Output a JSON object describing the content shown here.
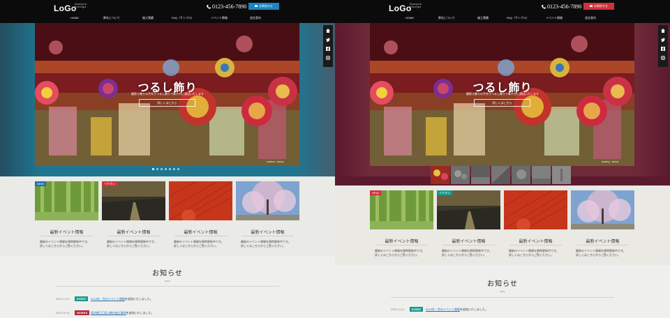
{
  "brand": {
    "logo": "LoGo",
    "logo_sub_1": "Sample",
    "logo_sub_2": "Design"
  },
  "header": {
    "phone": "0123-456-7890",
    "contact_label": "お問合わせ"
  },
  "nav": [
    "HOME",
    "弊社について",
    "施工実績",
    "FAQ（サンプル）",
    "イベント情報",
    "会社案内"
  ],
  "hero": {
    "title": "つるし飾り",
    "subtitle": "雛祭り飾りの手作りつるし飾りで華やかに演出いたします",
    "button": "詳しくはこちら",
    "caption": "SAMPLE - IMAGE"
  },
  "sns": [
    "home-icon",
    "twitter-icon",
    "facebook-icon",
    "instagram-icon"
  ],
  "left_slider": {
    "dots": [
      "1",
      "2",
      "3",
      "4",
      "5",
      "6",
      "7"
    ],
    "active": 0
  },
  "right_slider": {
    "thumbs": [
      "1",
      "2",
      "3",
      "4",
      "5",
      "6",
      "7"
    ]
  },
  "cards": [
    {
      "badge": "NEW!",
      "badge_color": "#1f6fb5",
      "title": "最新イベント情報",
      "text": [
        "最新のイベント情報を随時更新中です。",
        "詳しくはこちらからご覧ください。"
      ]
    },
    {
      "badge": "イチオシ",
      "badge_color": "#d1303c",
      "title": "最新イベント情報",
      "text": [
        "最新のイベント情報を随時更新中です。",
        "詳しくはこちらからご覧ください。"
      ]
    },
    {
      "badge": "",
      "badge_color": "",
      "title": "最新イベント情報",
      "text": [
        "最新のイベント情報を随時更新中です。",
        "詳しくはこちらからご覧ください。"
      ]
    },
    {
      "badge": "",
      "badge_color": "",
      "title": "最新イベント情報",
      "text": [
        "最新のイベント情報を随時更新中です。",
        "詳しくはこちらからご覧ください。"
      ]
    }
  ],
  "cards_right": [
    {
      "badge": "NEW!",
      "badge_color": "#d1303c"
    },
    {
      "badge": "イチオシ",
      "badge_color": "#169a8e"
    },
    {
      "badge": "",
      "badge_color": ""
    },
    {
      "badge": "",
      "badge_color": ""
    }
  ],
  "news": {
    "title": "お知らせ",
    "sub": "News",
    "items": [
      {
        "date": "2020.11.01",
        "tag": "EVENT",
        "tag_color": "#169a8e",
        "link": "2019年・冬のイベント情報",
        "rest": "を追加いたしました。"
      },
      {
        "date": "2020.10.01",
        "tag": "WORKS",
        "tag_color": "#b02b3c",
        "link": "東京都〇〇区X様の施工事例",
        "rest": "を追加いたしました。"
      }
    ]
  }
}
